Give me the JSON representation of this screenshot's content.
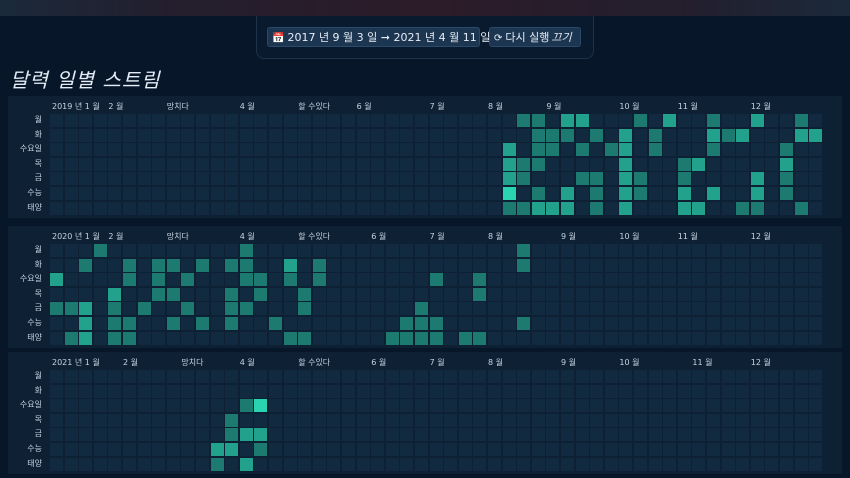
{
  "toolbar": {
    "range_icon": "calendar-icon",
    "range_label": "2017 년 9 월 3 일 ➞ 2021 년 4 월 11 일",
    "rerun_icon": "refresh-icon",
    "rerun_label": "다시 실행",
    "rerun_suffix": "끄기"
  },
  "page_title": "달력 일별 스트림",
  "day_labels": [
    "월",
    "화",
    "수요일",
    "목",
    "금",
    "수능",
    "태양"
  ],
  "colors": {
    "bg": "#08162a",
    "panel": "#0d2034",
    "empty": "#112a3f",
    "levels": [
      "#185e5c",
      "#1c7a70",
      "#22a28c",
      "#2ad4b0"
    ]
  },
  "years": [
    {
      "label": "2019 년 1 월",
      "months": [
        {
          "label": "2 월",
          "week": 4
        },
        {
          "label": "망치다",
          "week": 8
        },
        {
          "label": "4 월",
          "week": 13
        },
        {
          "label": "할 수있다",
          "week": 17
        },
        {
          "label": "6 월",
          "week": 21
        },
        {
          "label": "7 월",
          "week": 26
        },
        {
          "label": "8 월",
          "week": 30
        },
        {
          "label": "9 월",
          "week": 34
        },
        {
          "label": "10 월",
          "week": 39
        },
        {
          "label": "11 월",
          "week": 43
        },
        {
          "label": "12 월",
          "week": 48
        }
      ],
      "activity": [
        [
          32,
          0,
          1
        ],
        [
          33,
          0,
          1
        ],
        [
          35,
          0,
          2
        ],
        [
          36,
          0,
          2
        ],
        [
          40,
          0,
          1
        ],
        [
          42,
          0,
          2
        ],
        [
          45,
          0,
          1
        ],
        [
          48,
          0,
          2
        ],
        [
          51,
          0,
          1
        ],
        [
          33,
          1,
          1
        ],
        [
          34,
          1,
          1
        ],
        [
          35,
          1,
          1
        ],
        [
          37,
          1,
          1
        ],
        [
          39,
          1,
          2
        ],
        [
          41,
          1,
          1
        ],
        [
          45,
          1,
          2
        ],
        [
          46,
          1,
          1
        ],
        [
          47,
          1,
          2
        ],
        [
          51,
          1,
          2
        ],
        [
          52,
          1,
          2
        ],
        [
          31,
          2,
          2
        ],
        [
          33,
          2,
          1
        ],
        [
          34,
          2,
          1
        ],
        [
          36,
          2,
          1
        ],
        [
          38,
          2,
          1
        ],
        [
          39,
          2,
          2
        ],
        [
          41,
          2,
          1
        ],
        [
          45,
          2,
          1
        ],
        [
          50,
          2,
          1
        ],
        [
          31,
          3,
          2
        ],
        [
          32,
          3,
          1
        ],
        [
          33,
          3,
          1
        ],
        [
          39,
          3,
          2
        ],
        [
          43,
          3,
          1
        ],
        [
          44,
          3,
          2
        ],
        [
          50,
          3,
          2
        ],
        [
          31,
          4,
          2
        ],
        [
          32,
          4,
          1
        ],
        [
          36,
          4,
          1
        ],
        [
          37,
          4,
          1
        ],
        [
          39,
          4,
          2
        ],
        [
          40,
          4,
          1
        ],
        [
          43,
          4,
          1
        ],
        [
          48,
          4,
          2
        ],
        [
          50,
          4,
          1
        ],
        [
          31,
          5,
          3
        ],
        [
          33,
          5,
          1
        ],
        [
          35,
          5,
          2
        ],
        [
          37,
          5,
          1
        ],
        [
          39,
          5,
          2
        ],
        [
          40,
          5,
          1
        ],
        [
          43,
          5,
          2
        ],
        [
          45,
          5,
          2
        ],
        [
          48,
          5,
          2
        ],
        [
          50,
          5,
          1
        ],
        [
          31,
          6,
          1
        ],
        [
          32,
          6,
          1
        ],
        [
          33,
          6,
          2
        ],
        [
          34,
          6,
          2
        ],
        [
          35,
          6,
          2
        ],
        [
          37,
          6,
          1
        ],
        [
          39,
          6,
          2
        ],
        [
          43,
          6,
          2
        ],
        [
          44,
          6,
          2
        ],
        [
          47,
          6,
          1
        ],
        [
          48,
          6,
          1
        ],
        [
          51,
          6,
          1
        ]
      ]
    },
    {
      "label": "2020 년 1 월",
      "months": [
        {
          "label": "2 월",
          "week": 4
        },
        {
          "label": "망치다",
          "week": 8
        },
        {
          "label": "4 월",
          "week": 13
        },
        {
          "label": "할 수있다",
          "week": 17
        },
        {
          "label": "6 월",
          "week": 22
        },
        {
          "label": "7 월",
          "week": 26
        },
        {
          "label": "8 월",
          "week": 30
        },
        {
          "label": "9 월",
          "week": 35
        },
        {
          "label": "10 월",
          "week": 39
        },
        {
          "label": "11 월",
          "week": 43
        },
        {
          "label": "12 월",
          "week": 48
        }
      ],
      "activity": [
        [
          3,
          0,
          1
        ],
        [
          13,
          0,
          1
        ],
        [
          32,
          0,
          1
        ],
        [
          2,
          1,
          1
        ],
        [
          5,
          1,
          1
        ],
        [
          7,
          1,
          1
        ],
        [
          8,
          1,
          1
        ],
        [
          10,
          1,
          1
        ],
        [
          12,
          1,
          1
        ],
        [
          13,
          1,
          1
        ],
        [
          16,
          1,
          2
        ],
        [
          18,
          1,
          1
        ],
        [
          32,
          1,
          1
        ],
        [
          0,
          2,
          2
        ],
        [
          5,
          2,
          1
        ],
        [
          7,
          2,
          1
        ],
        [
          9,
          2,
          1
        ],
        [
          13,
          2,
          1
        ],
        [
          14,
          2,
          1
        ],
        [
          16,
          2,
          1
        ],
        [
          18,
          2,
          1
        ],
        [
          26,
          2,
          1
        ],
        [
          29,
          2,
          1
        ],
        [
          4,
          3,
          2
        ],
        [
          7,
          3,
          1
        ],
        [
          8,
          3,
          1
        ],
        [
          12,
          3,
          1
        ],
        [
          14,
          3,
          1
        ],
        [
          17,
          3,
          1
        ],
        [
          29,
          3,
          1
        ],
        [
          0,
          4,
          1
        ],
        [
          1,
          4,
          1
        ],
        [
          2,
          4,
          2
        ],
        [
          4,
          4,
          1
        ],
        [
          6,
          4,
          1
        ],
        [
          9,
          4,
          1
        ],
        [
          12,
          4,
          1
        ],
        [
          13,
          4,
          1
        ],
        [
          17,
          4,
          1
        ],
        [
          25,
          4,
          1
        ],
        [
          2,
          5,
          2
        ],
        [
          4,
          5,
          1
        ],
        [
          5,
          5,
          1
        ],
        [
          8,
          5,
          1
        ],
        [
          10,
          5,
          1
        ],
        [
          12,
          5,
          1
        ],
        [
          15,
          5,
          1
        ],
        [
          24,
          5,
          1
        ],
        [
          25,
          5,
          1
        ],
        [
          26,
          5,
          1
        ],
        [
          32,
          5,
          1
        ],
        [
          1,
          6,
          1
        ],
        [
          2,
          6,
          2
        ],
        [
          4,
          6,
          1
        ],
        [
          5,
          6,
          1
        ],
        [
          16,
          6,
          1
        ],
        [
          17,
          6,
          1
        ],
        [
          23,
          6,
          1
        ],
        [
          24,
          6,
          1
        ],
        [
          25,
          6,
          1
        ],
        [
          26,
          6,
          1
        ],
        [
          28,
          6,
          1
        ],
        [
          29,
          6,
          1
        ]
      ]
    },
    {
      "label": "2021 년 1 월",
      "months": [
        {
          "label": "2 월",
          "week": 5
        },
        {
          "label": "망치다",
          "week": 9
        },
        {
          "label": "4 월",
          "week": 13
        },
        {
          "label": "할 수있다",
          "week": 17
        },
        {
          "label": "6 월",
          "week": 22
        },
        {
          "label": "7 월",
          "week": 26
        },
        {
          "label": "8 월",
          "week": 30
        },
        {
          "label": "9 월",
          "week": 35
        },
        {
          "label": "10 월",
          "week": 39
        },
        {
          "label": "11 월",
          "week": 44
        },
        {
          "label": "12 월",
          "week": 48
        }
      ],
      "activity": [
        [
          13,
          2,
          1
        ],
        [
          14,
          2,
          3
        ],
        [
          12,
          3,
          1
        ],
        [
          12,
          4,
          1
        ],
        [
          13,
          4,
          2
        ],
        [
          14,
          4,
          2
        ],
        [
          11,
          5,
          2
        ],
        [
          12,
          5,
          2
        ],
        [
          14,
          5,
          1
        ],
        [
          11,
          6,
          1
        ],
        [
          13,
          6,
          2
        ]
      ]
    }
  ]
}
